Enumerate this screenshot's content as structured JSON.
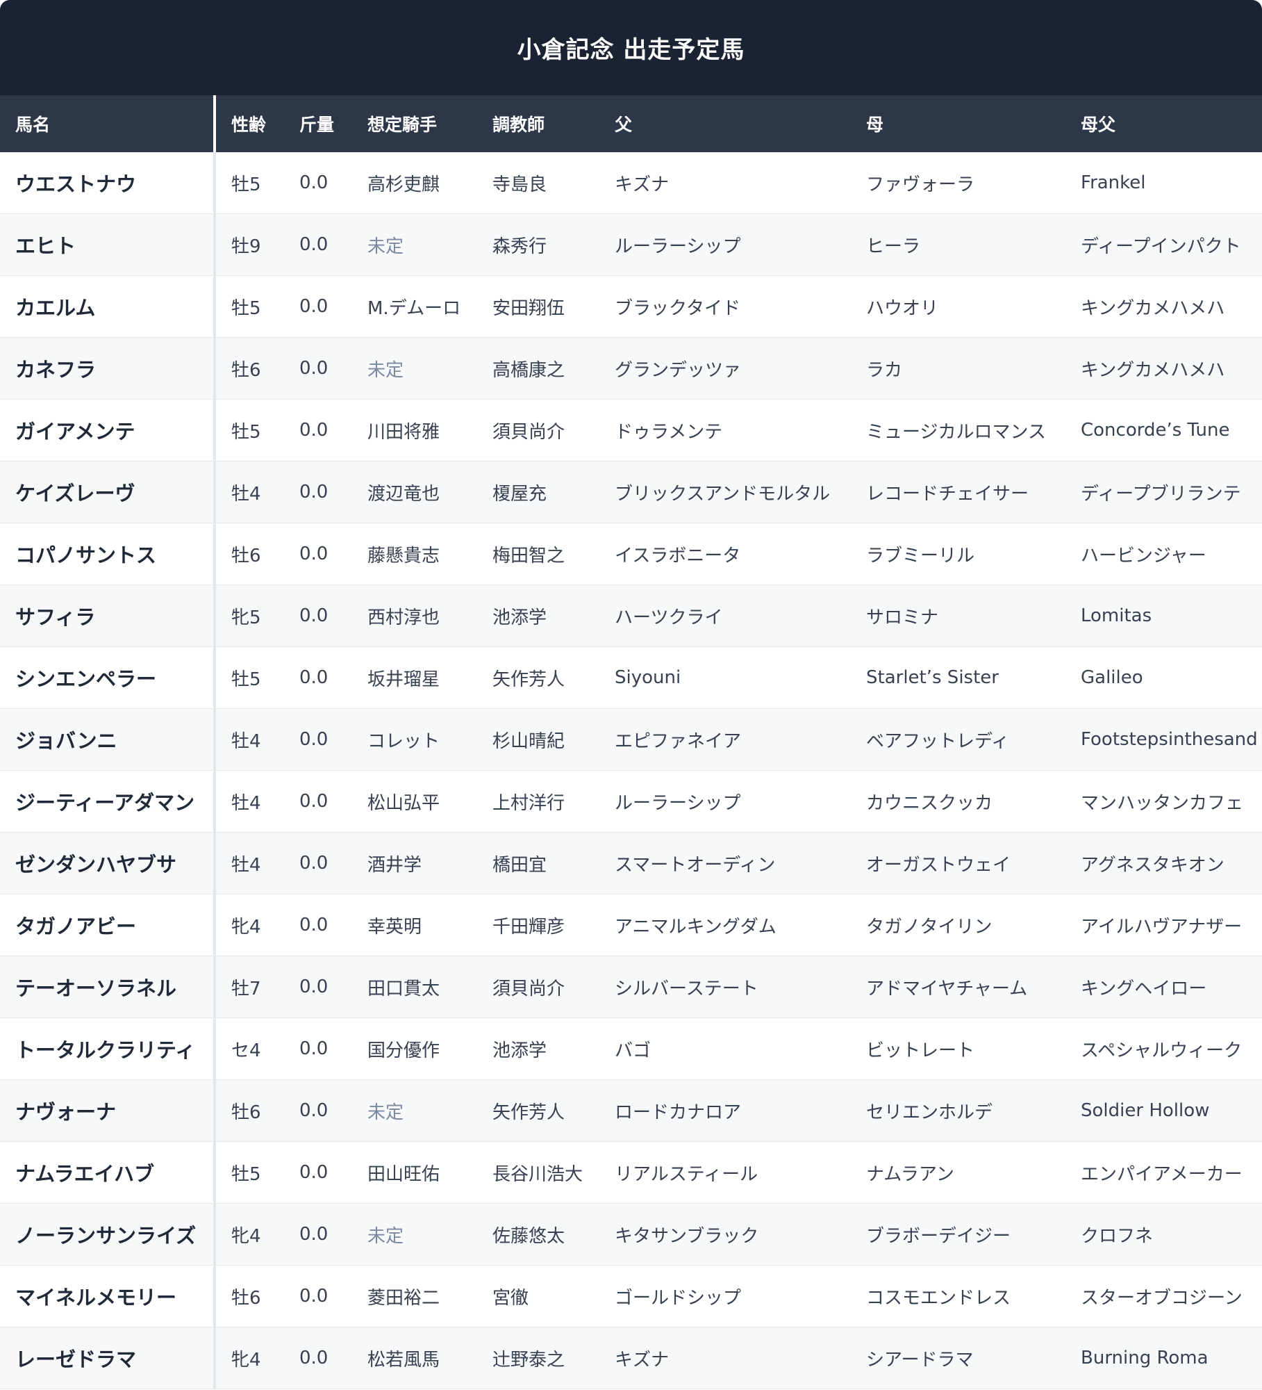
{
  "header": {
    "title": "小倉記念 出走予定馬"
  },
  "table": {
    "columns": [
      "馬名",
      "性齢",
      "斤量",
      "想定騎手",
      "調教師",
      "父",
      "母",
      "母父"
    ],
    "undecided_label": "未定",
    "rows": [
      [
        "ウエストナウ",
        "牡5",
        "0.0",
        "高杉吏麒",
        "寺島良",
        "キズナ",
        "ファヴォーラ",
        "Frankel"
      ],
      [
        "エヒト",
        "牡9",
        "0.0",
        "未定",
        "森秀行",
        "ルーラーシップ",
        "ヒーラ",
        "ディープインパクト"
      ],
      [
        "カエルム",
        "牡5",
        "0.0",
        "M.デムーロ",
        "安田翔伍",
        "ブラックタイド",
        "ハウオリ",
        "キングカメハメハ"
      ],
      [
        "カネフラ",
        "牡6",
        "0.0",
        "未定",
        "高橋康之",
        "グランデッツァ",
        "ラカ",
        "キングカメハメハ"
      ],
      [
        "ガイアメンテ",
        "牡5",
        "0.0",
        "川田将雅",
        "須貝尚介",
        "ドゥラメンテ",
        "ミュージカルロマンス",
        "Concorde’s Tune"
      ],
      [
        "ケイズレーヴ",
        "牡4",
        "0.0",
        "渡辺竜也",
        "榎屋充",
        "ブリックスアンドモルタル",
        "レコードチェイサー",
        "ディープブリランテ"
      ],
      [
        "コパノサントス",
        "牡6",
        "0.0",
        "藤懸貴志",
        "梅田智之",
        "イスラボニータ",
        "ラブミーリル",
        "ハービンジャー"
      ],
      [
        "サフィラ",
        "牝5",
        "0.0",
        "西村淳也",
        "池添学",
        "ハーツクライ",
        "サロミナ",
        "Lomitas"
      ],
      [
        "シンエンペラー",
        "牡5",
        "0.0",
        "坂井瑠星",
        "矢作芳人",
        "Siyouni",
        "Starlet’s Sister",
        "Galileo"
      ],
      [
        "ジョバンニ",
        "牡4",
        "0.0",
        "コレット",
        "杉山晴紀",
        "エピファネイア",
        "ベアフットレディ",
        "Footstepsinthesand"
      ],
      [
        "ジーティーアダマン",
        "牡4",
        "0.0",
        "松山弘平",
        "上村洋行",
        "ルーラーシップ",
        "カウニスクッカ",
        "マンハッタンカフェ"
      ],
      [
        "ゼンダンハヤブサ",
        "牡4",
        "0.0",
        "酒井学",
        "橋田宜",
        "スマートオーディン",
        "オーガストウェイ",
        "アグネスタキオン"
      ],
      [
        "タガノアビー",
        "牝4",
        "0.0",
        "幸英明",
        "千田輝彦",
        "アニマルキングダム",
        "タガノタイリン",
        "アイルハヴアナザー"
      ],
      [
        "テーオーソラネル",
        "牡7",
        "0.0",
        "田口貫太",
        "須貝尚介",
        "シルバーステート",
        "アドマイヤチャーム",
        "キングヘイロー"
      ],
      [
        "トータルクラリティ",
        "セ4",
        "0.0",
        "国分優作",
        "池添学",
        "バゴ",
        "ビットレート",
        "スペシャルウィーク"
      ],
      [
        "ナヴォーナ",
        "牡6",
        "0.0",
        "未定",
        "矢作芳人",
        "ロードカナロア",
        "セリエンホルデ",
        "Soldier Hollow"
      ],
      [
        "ナムラエイハブ",
        "牡5",
        "0.0",
        "田山旺佑",
        "長谷川浩大",
        "リアルスティール",
        "ナムラアン",
        "エンパイアメーカー"
      ],
      [
        "ノーランサンライズ",
        "牝4",
        "0.0",
        "未定",
        "佐藤悠太",
        "キタサンブラック",
        "ブラボーデイジー",
        "クロフネ"
      ],
      [
        "マイネルメモリー",
        "牡6",
        "0.0",
        "菱田裕二",
        "宮徹",
        "ゴールドシップ",
        "コスモエンドレス",
        "スターオブコジーン"
      ],
      [
        "レーゼドラマ",
        "牝4",
        "0.0",
        "松若風馬",
        "辻野泰之",
        "キズナ",
        "シアードラマ",
        "Burning Roma"
      ]
    ]
  },
  "colors": {
    "header_bg": "#1b2231",
    "table_head_bg": "#2d3748",
    "undecided_text": "#7b8aa0"
  }
}
